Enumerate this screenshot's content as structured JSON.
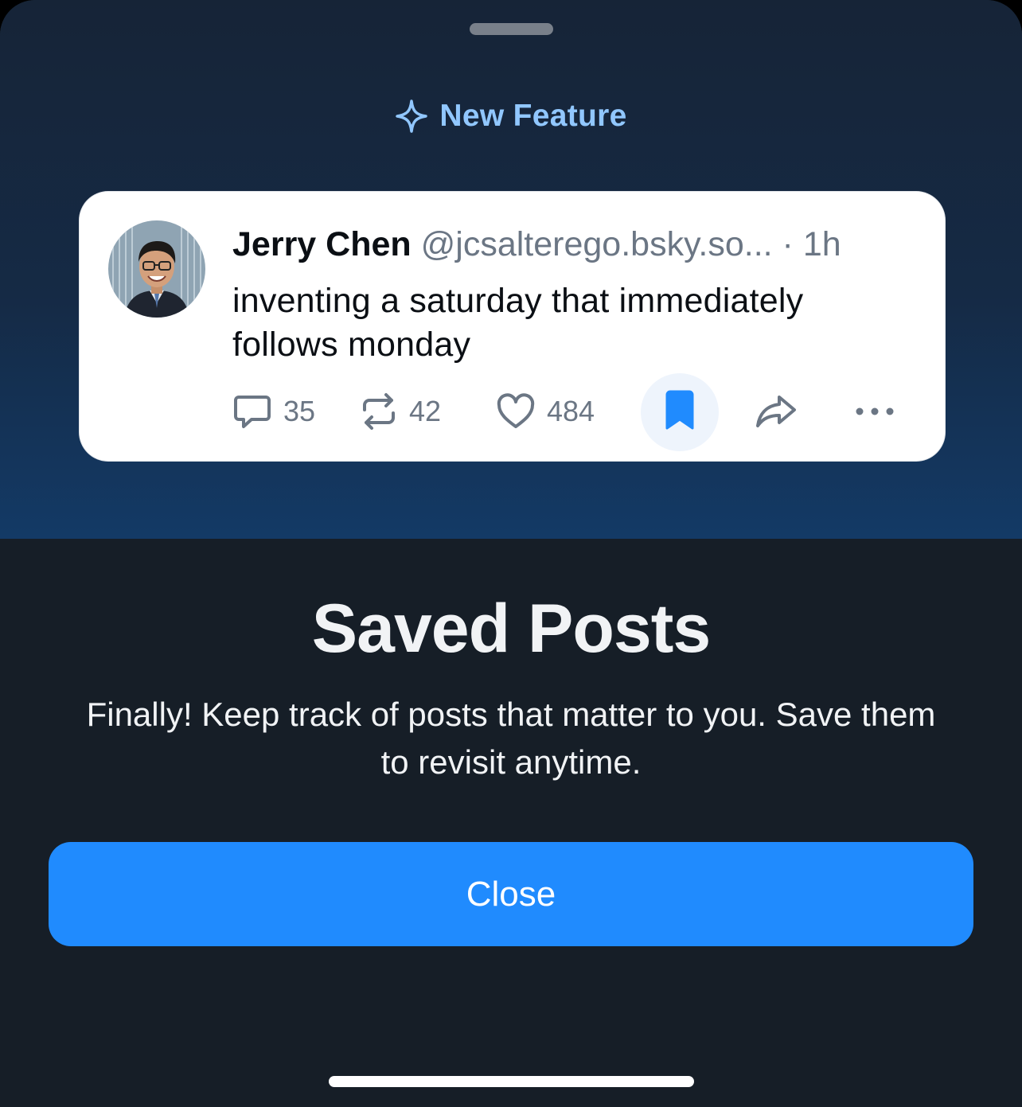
{
  "feature_tag": {
    "icon": "sparkle-icon",
    "label": "New Feature",
    "color": "#91c7ff"
  },
  "post": {
    "author_name": "Jerry Chen",
    "author_handle": "@jcsalterego.bsky.so...",
    "separator": "·",
    "time": "1h",
    "text": "inventing a saturday that immediately follows monday",
    "actions": {
      "reply": {
        "icon": "reply-icon",
        "count": "35"
      },
      "repost": {
        "icon": "repost-icon",
        "count": "42"
      },
      "like": {
        "icon": "heart-icon",
        "count": "484"
      },
      "bookmark": {
        "icon": "bookmark-icon",
        "active": true,
        "color": "#208bfe"
      },
      "share": {
        "icon": "share-icon"
      },
      "more": {
        "icon": "more-icon"
      }
    }
  },
  "title": "Saved Posts",
  "description": "Finally! Keep track of posts that matter to you. Save them to revisit anytime.",
  "close_button": {
    "label": "Close",
    "color": "#208bfe"
  }
}
